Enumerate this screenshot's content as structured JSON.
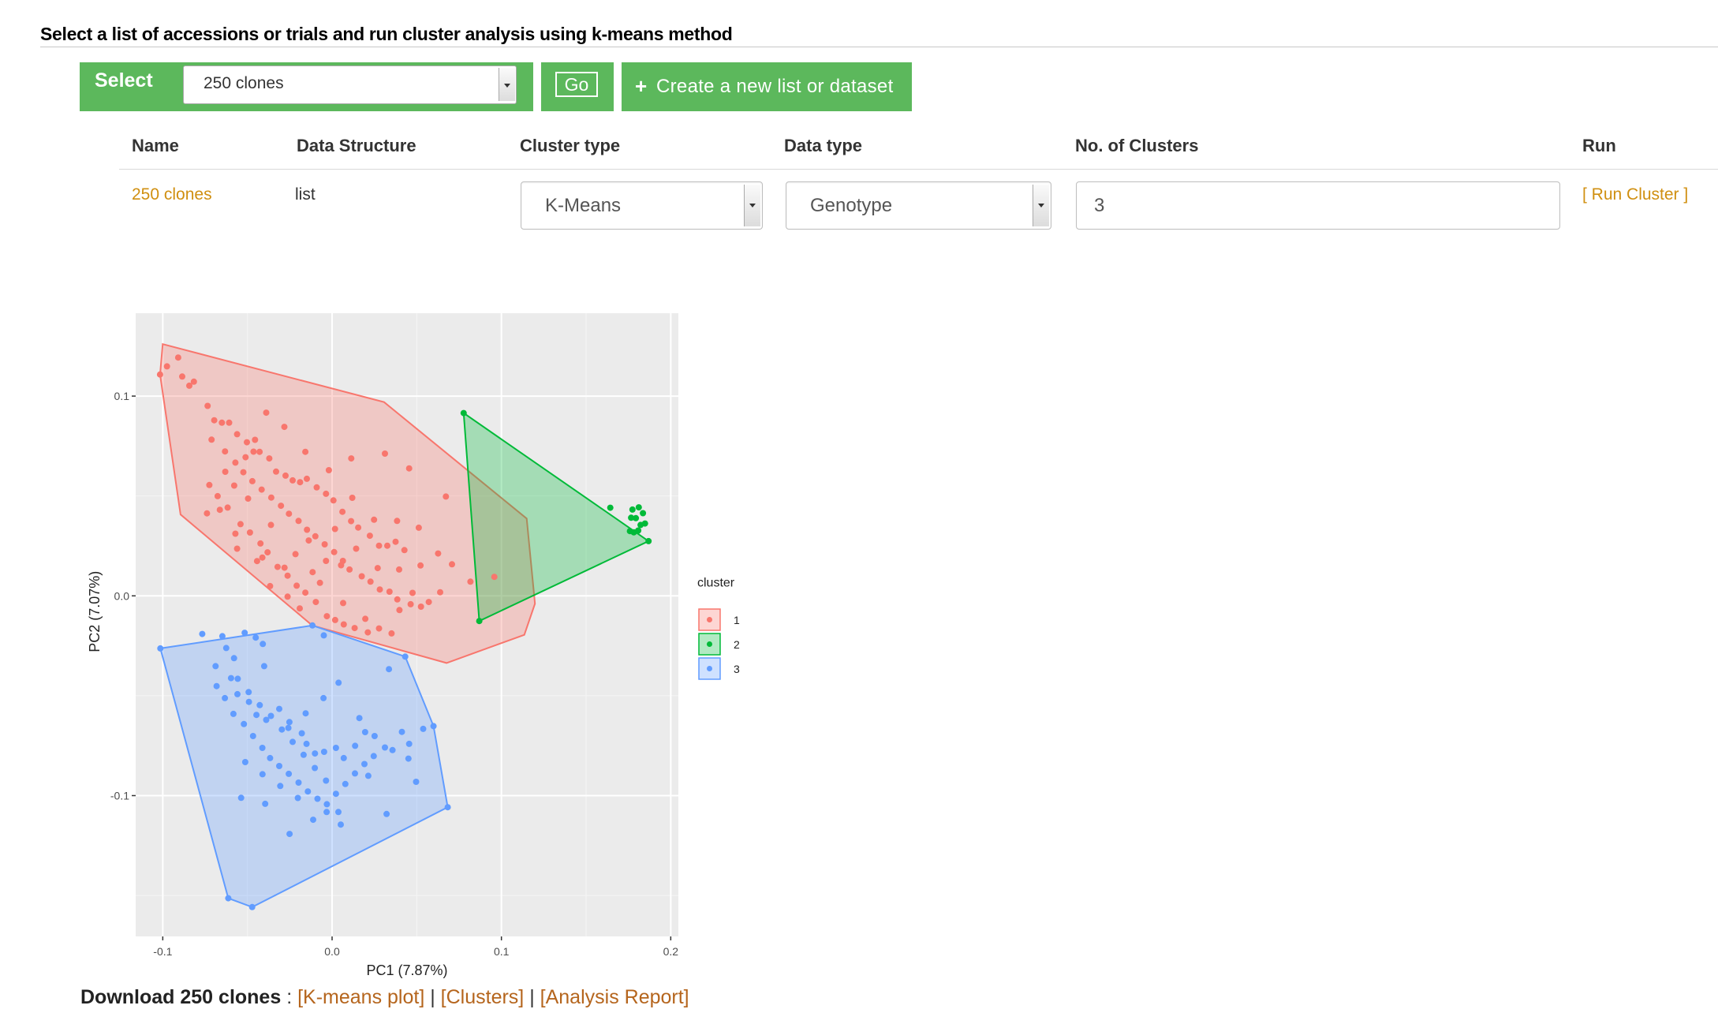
{
  "header": {
    "title": "Select a list of accessions or trials and run cluster analysis using k-means method"
  },
  "selector": {
    "label": "Select",
    "value": "250 clones",
    "go_label": "Go",
    "create_label": "Create a new list or dataset"
  },
  "table": {
    "headers": [
      "Name",
      "Data Structure",
      "Cluster type",
      "Data type",
      "No. of Clusters",
      "Run"
    ],
    "row": {
      "name": "250 clones",
      "structure": "list",
      "cluster_type": "K-Means",
      "data_type": "Genotype",
      "clusters": "3",
      "run_label": "[ Run Cluster ]"
    }
  },
  "chart_data": {
    "type": "scatter",
    "title": "",
    "xlabel": "PC1 (7.87%)",
    "ylabel": "PC2 (7.07%)",
    "xlim": [
      -0.116,
      0.2045
    ],
    "ylim": [
      -0.1705,
      0.1415
    ],
    "xticks": [
      -0.1,
      0.0,
      0.1,
      0.2
    ],
    "xtick_labels": [
      "-0.1",
      "0.0",
      "0.1",
      "0.2"
    ],
    "yticks": [
      -0.1,
      0.0,
      0.1
    ],
    "ytick_labels": [
      "-0.1",
      "0.0",
      "0.1"
    ],
    "grid": true,
    "legend_title": "cluster",
    "legend_position": "right",
    "series": [
      {
        "name": "1",
        "color": "#f8766d",
        "hull": [
          [
            -0.1,
            0.126
          ],
          [
            0.0307,
            0.097
          ],
          [
            0.1149,
            0.0387
          ],
          [
            0.1198,
            -0.0039
          ],
          [
            0.1135,
            -0.0195
          ],
          [
            0.0676,
            -0.0336
          ],
          [
            -0.0117,
            -0.0148
          ],
          [
            -0.0895,
            0.0407
          ],
          [
            -0.1016,
            0.1108
          ]
        ],
        "points": [
          [
            -0.1016,
            0.1108
          ],
          [
            -0.0975,
            0.1149
          ],
          [
            -0.0909,
            0.1193
          ],
          [
            -0.0885,
            0.1098
          ],
          [
            -0.0843,
            0.1052
          ],
          [
            -0.0816,
            0.1072
          ],
          [
            -0.0735,
            0.0951
          ],
          [
            -0.0696,
            0.0879
          ],
          [
            -0.0651,
            0.0867
          ],
          [
            -0.0608,
            0.0867
          ],
          [
            -0.0561,
            0.0809
          ],
          [
            -0.0503,
            0.0769
          ],
          [
            -0.0464,
            0.0722
          ],
          [
            -0.0428,
            0.0721
          ],
          [
            -0.0371,
            0.0688
          ],
          [
            -0.0331,
            0.0622
          ],
          [
            -0.0275,
            0.0602
          ],
          [
            -0.0233,
            0.0578
          ],
          [
            -0.0189,
            0.0569
          ],
          [
            -0.0149,
            0.0586
          ],
          [
            -0.0091,
            0.0543
          ],
          [
            -0.0036,
            0.0511
          ],
          [
            0.0008,
            0.0478
          ],
          [
            0.0061,
            0.0421
          ],
          [
            0.0112,
            0.0374
          ],
          [
            0.0154,
            0.0342
          ],
          [
            0.0223,
            0.0301
          ],
          [
            0.0277,
            0.0251
          ],
          [
            0.0326,
            0.0251
          ],
          [
            0.0375,
            0.0271
          ],
          [
            0.0427,
            0.0229
          ],
          [
            -0.0712,
            0.0782
          ],
          [
            -0.0632,
            0.0723
          ],
          [
            -0.0571,
            0.0667
          ],
          [
            -0.0524,
            0.0619
          ],
          [
            -0.0471,
            0.0574
          ],
          [
            -0.0416,
            0.0532
          ],
          [
            -0.0359,
            0.0492
          ],
          [
            -0.0302,
            0.0451
          ],
          [
            -0.0255,
            0.0411
          ],
          [
            -0.0198,
            0.0375
          ],
          [
            -0.0148,
            0.0331
          ],
          [
            -0.0099,
            0.0298
          ],
          [
            -0.0044,
            0.0258
          ],
          [
            0.0012,
            0.0219
          ],
          [
            0.0064,
            0.0175
          ],
          [
            0.0103,
            0.0132
          ],
          [
            0.0175,
            0.0098
          ],
          [
            0.0227,
            0.0071
          ],
          [
            0.0282,
            0.0032
          ],
          [
            0.0339,
            0.0021
          ],
          [
            0.0385,
            -0.0018
          ],
          [
            0.0464,
            -0.0042
          ],
          [
            0.0525,
            -0.0054
          ],
          [
            0.0571,
            -0.0031
          ],
          [
            0.0638,
            0.0018
          ],
          [
            -0.0725,
            0.0555
          ],
          [
            -0.0676,
            0.0499
          ],
          [
            -0.0617,
            0.0442
          ],
          [
            -0.0541,
            0.0359
          ],
          [
            -0.0485,
            0.0317
          ],
          [
            -0.0423,
            0.0262
          ],
          [
            -0.0381,
            0.0218
          ],
          [
            -0.0322,
            0.0145
          ],
          [
            -0.0263,
            0.0101
          ],
          [
            -0.0209,
            0.0051
          ],
          [
            -0.0158,
            0.0016
          ],
          [
            -0.0096,
            -0.0031
          ],
          [
            -0.0031,
            -0.0102
          ],
          [
            0.0018,
            -0.0121
          ],
          [
            0.0069,
            -0.0143
          ],
          [
            0.0133,
            -0.0161
          ],
          [
            0.0211,
            -0.0183
          ],
          [
            0.0277,
            -0.0163
          ],
          [
            0.0351,
            -0.0188
          ],
          [
            0.0398,
            -0.0071
          ],
          [
            0.0475,
            0.0015
          ],
          [
            -0.0631,
            0.0621
          ],
          [
            -0.0496,
            0.0487
          ],
          [
            -0.0361,
            0.0355
          ],
          [
            -0.0216,
            0.0209
          ],
          [
            -0.0072,
            0.0065
          ],
          [
            0.0065,
            -0.0036
          ],
          [
            0.0196,
            -0.0115
          ],
          [
            -0.0571,
            0.0311
          ],
          [
            -0.0412,
            0.0192
          ],
          [
            -0.0281,
            0.0141
          ],
          [
            -0.0138,
            0.0277
          ],
          [
            0.0017,
            0.0335
          ],
          [
            0.0119,
            0.0491
          ],
          [
            0.0248,
            0.0381
          ],
          [
            0.0384,
            0.0375
          ],
          [
            0.0512,
            0.0341
          ],
          [
            0.0708,
            0.0158
          ],
          [
            0.0817,
            0.0071
          ],
          [
            0.0958,
            0.0095
          ],
          [
            0.0672,
            0.0497
          ],
          [
            0.0455,
            0.0638
          ],
          [
            0.0312,
            0.0712
          ],
          [
            0.0113,
            0.0688
          ],
          [
            -0.0019,
            0.0629
          ],
          [
            -0.0158,
            0.0721
          ],
          [
            -0.0282,
            0.0846
          ],
          [
            -0.0389,
            0.0917
          ],
          [
            -0.0455,
            0.0781
          ],
          [
            -0.0511,
            0.0694
          ],
          [
            -0.0578,
            0.0552
          ],
          [
            -0.0663,
            0.0431
          ],
          [
            -0.0739,
            0.0413
          ],
          [
            -0.0561,
            0.0236
          ],
          [
            -0.0443,
            0.0174
          ],
          [
            -0.0366,
            0.0049
          ],
          [
            -0.0263,
            -0.0004
          ],
          [
            -0.0191,
            -0.0063
          ],
          [
            -0.0115,
            0.0119
          ],
          [
            -0.0036,
            0.0175
          ],
          [
            0.0053,
            0.0153
          ],
          [
            0.0142,
            0.0236
          ],
          [
            0.0269,
            0.0139
          ],
          [
            0.0396,
            0.0132
          ],
          [
            0.0522,
            0.0152
          ],
          [
            0.0626,
            0.0212
          ]
        ]
      },
      {
        "name": "2",
        "color": "#00ba38",
        "hull": [
          [
            0.0777,
            0.0915
          ],
          [
            0.1869,
            0.0274
          ],
          [
            0.0869,
            -0.0126
          ]
        ],
        "points": [
          [
            0.0777,
            0.0915
          ],
          [
            0.1869,
            0.0274
          ],
          [
            0.0869,
            -0.0126
          ],
          [
            0.1643,
            0.0441
          ],
          [
            0.1774,
            0.0432
          ],
          [
            0.1811,
            0.0443
          ],
          [
            0.1836,
            0.0414
          ],
          [
            0.1766,
            0.0391
          ],
          [
            0.1794,
            0.0389
          ],
          [
            0.1848,
            0.0362
          ],
          [
            0.1822,
            0.0355
          ],
          [
            0.1759,
            0.0324
          ],
          [
            0.1782,
            0.0318
          ],
          [
            0.1808,
            0.0327
          ]
        ]
      },
      {
        "name": "3",
        "color": "#619cff",
        "hull": [
          [
            -0.1014,
            -0.0263
          ],
          [
            -0.0116,
            -0.0148
          ],
          [
            0.0432,
            -0.0304
          ],
          [
            0.0599,
            -0.0652
          ],
          [
            0.0683,
            -0.1058
          ],
          [
            -0.0472,
            -0.1558
          ],
          [
            -0.0613,
            -0.1514
          ]
        ],
        "points": [
          [
            -0.1014,
            -0.0263
          ],
          [
            -0.0116,
            -0.0148
          ],
          [
            0.0432,
            -0.0304
          ],
          [
            0.0599,
            -0.0652
          ],
          [
            0.0683,
            -0.1058
          ],
          [
            -0.0472,
            -0.1558
          ],
          [
            -0.0613,
            -0.1514
          ],
          [
            -0.0767,
            -0.0191
          ],
          [
            -0.0648,
            -0.0202
          ],
          [
            -0.0516,
            -0.0185
          ],
          [
            -0.0451,
            -0.0209
          ],
          [
            -0.0409,
            -0.0241
          ],
          [
            -0.0049,
            -0.0198
          ],
          [
            0.0336,
            -0.0367
          ],
          [
            -0.0688,
            -0.0352
          ],
          [
            -0.0597,
            -0.0412
          ],
          [
            -0.0559,
            -0.0492
          ],
          [
            -0.0491,
            -0.0531
          ],
          [
            -0.0447,
            -0.0596
          ],
          [
            -0.0389,
            -0.0621
          ],
          [
            -0.0312,
            -0.0566
          ],
          [
            -0.0252,
            -0.0632
          ],
          [
            -0.0179,
            -0.0688
          ],
          [
            -0.0151,
            -0.0741
          ],
          [
            -0.0101,
            -0.0789
          ],
          [
            -0.0047,
            -0.0781
          ],
          [
            0.0023,
            -0.0761
          ],
          [
            0.0069,
            -0.0812
          ],
          [
            0.0136,
            -0.0751
          ],
          [
            0.0195,
            -0.0682
          ],
          [
            0.0251,
            -0.0702
          ],
          [
            0.0357,
            -0.0772
          ],
          [
            0.0412,
            -0.0681
          ],
          [
            0.0455,
            -0.0741
          ],
          [
            0.0538,
            -0.0666
          ],
          [
            -0.0682,
            -0.0452
          ],
          [
            -0.0633,
            -0.0512
          ],
          [
            -0.0583,
            -0.0591
          ],
          [
            -0.0521,
            -0.0642
          ],
          [
            -0.0467,
            -0.0702
          ],
          [
            -0.0412,
            -0.0761
          ],
          [
            -0.0366,
            -0.0812
          ],
          [
            -0.0312,
            -0.0852
          ],
          [
            -0.0256,
            -0.0891
          ],
          [
            -0.0198,
            -0.0935
          ],
          [
            -0.0143,
            -0.0979
          ],
          [
            -0.0086,
            -0.1016
          ],
          [
            -0.0031,
            -0.1043
          ],
          [
            0.0023,
            -0.0991
          ],
          [
            0.0078,
            -0.0942
          ],
          [
            0.0135,
            -0.0889
          ],
          [
            0.0191,
            -0.0842
          ],
          [
            0.0246,
            -0.0802
          ],
          [
            0.0312,
            -0.0759
          ],
          [
            0.0451,
            -0.0815
          ],
          [
            0.0496,
            -0.0931
          ],
          [
            -0.0557,
            -0.0415
          ],
          [
            -0.0493,
            -0.0482
          ],
          [
            -0.0427,
            -0.0547
          ],
          [
            -0.0361,
            -0.0601
          ],
          [
            -0.0297,
            -0.0669
          ],
          [
            -0.0233,
            -0.0731
          ],
          [
            -0.0168,
            -0.0796
          ],
          [
            -0.0102,
            -0.0862
          ],
          [
            -0.0036,
            -0.0925
          ],
          [
            0.0037,
            -0.1082
          ],
          [
            -0.0513,
            -0.0832
          ],
          [
            -0.0411,
            -0.0893
          ],
          [
            -0.0306,
            -0.0952
          ],
          [
            -0.0202,
            -0.1012
          ],
          [
            -0.0251,
            -0.1192
          ],
          [
            -0.0112,
            -0.1121
          ],
          [
            -0.0032,
            -0.1082
          ],
          [
            0.0051,
            -0.1145
          ],
          [
            -0.0537,
            -0.1011
          ],
          [
            -0.0395,
            -0.1041
          ],
          [
            -0.0258,
            -0.0661
          ],
          [
            -0.0156,
            -0.0588
          ],
          [
            -0.0051,
            -0.0512
          ],
          [
            0.0038,
            -0.0435
          ],
          [
            0.0161,
            -0.0612
          ],
          [
            0.0214,
            -0.0901
          ],
          [
            0.0322,
            -0.1092
          ],
          [
            -0.0625,
            -0.0261
          ],
          [
            -0.0579,
            -0.0312
          ],
          [
            -0.0401,
            -0.0352
          ]
        ]
      }
    ]
  },
  "download": {
    "label": "Download 250 clones",
    "sep": " : ",
    "links": [
      "[K-means plot]",
      "[Clusters]",
      "[Analysis Report]"
    ],
    "pipe": " | "
  }
}
